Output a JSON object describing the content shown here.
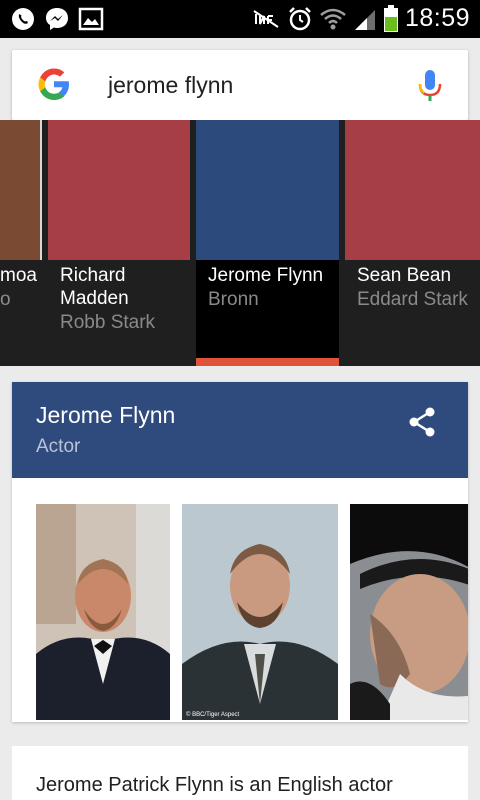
{
  "status_bar": {
    "time": "18:59",
    "left_icons": [
      "whatsapp-icon",
      "messenger-icon",
      "gallery-icon"
    ],
    "right_icons": [
      "nfc-icon",
      "alarm-icon",
      "wifi-icon",
      "signal-icon",
      "battery-icon"
    ]
  },
  "search": {
    "query": "jerome flynn"
  },
  "carousel": {
    "cards": [
      {
        "name": "moa",
        "role": "o",
        "color": "#7a4a33"
      },
      {
        "name": "Richard Madden",
        "role": "Robb Stark",
        "color": "#a63e45"
      },
      {
        "name": "Jerome Flynn",
        "role": "Bronn",
        "color": "#2d4a7d",
        "selected": true
      },
      {
        "name": "Sean Bean",
        "role": "Eddard Stark",
        "color": "#a63e45"
      }
    ]
  },
  "knowledge_panel": {
    "title": "Jerome Flynn",
    "subtitle": "Actor",
    "header_color": "#2f4a7c",
    "photo_caption": "© BBC/Tiger Aspect",
    "description": "Jerome Patrick Flynn is an English actor"
  }
}
